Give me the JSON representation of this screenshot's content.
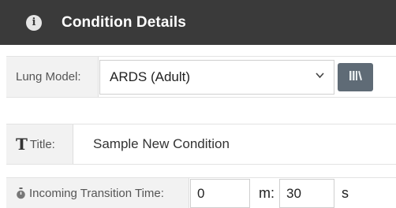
{
  "header": {
    "title": "Condition Details",
    "icon": "info-icon"
  },
  "lung_model": {
    "label": "Lung Model:",
    "selected": "ARDS (Adult)",
    "library_icon": "library-icon"
  },
  "title_field": {
    "label": "Title:",
    "value": "Sample New Condition"
  },
  "transition": {
    "label": "Incoming Transition Time:",
    "minutes": "0",
    "minutes_unit": "m:",
    "seconds": "30",
    "seconds_unit": "s"
  },
  "colors": {
    "header_bg": "#3a3a3a",
    "button_bg": "#5f6b76"
  }
}
